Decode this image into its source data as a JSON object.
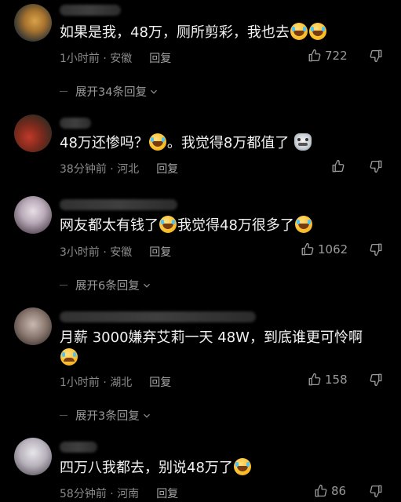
{
  "comments": [
    {
      "line1": "如果是我，48万，厕所剪彩，我也去",
      "time": "1小时前",
      "location": "安徽",
      "reply_label": "回复",
      "likes": "722",
      "replies_label": "展开34条回复"
    },
    {
      "line1a": "48万还惨吗？",
      "line1b": "。我觉得8万都值了",
      "time": "38分钟前",
      "location": "河北",
      "reply_label": "回复",
      "likes": ""
    },
    {
      "line1a": "网友都太有钱了",
      "line1b": "我觉得48万很多了",
      "time": "3小时前",
      "location": "安徽",
      "reply_label": "回复",
      "likes": "1062",
      "replies_label": "展开6条回复"
    },
    {
      "line1": "月薪 3000嫌弃艾莉一天 48W，到底谁更可怜啊",
      "time": "1小时前",
      "location": "湖北",
      "reply_label": "回复",
      "likes": "158",
      "replies_label": "展开3条回复"
    },
    {
      "line1": "四万八我都去，别说48万了",
      "time": "58分钟前",
      "location": "河南",
      "reply_label": "回复",
      "likes": "86"
    }
  ],
  "icons": {
    "like": "thumbs-up-icon",
    "dislike": "thumbs-down-icon",
    "expand": "chevron-down-icon",
    "emoji": "laughing-crying-emoji"
  },
  "colors": {
    "background": "#000000",
    "text": "#f2f2f2",
    "meta": "#8a8a8a"
  }
}
